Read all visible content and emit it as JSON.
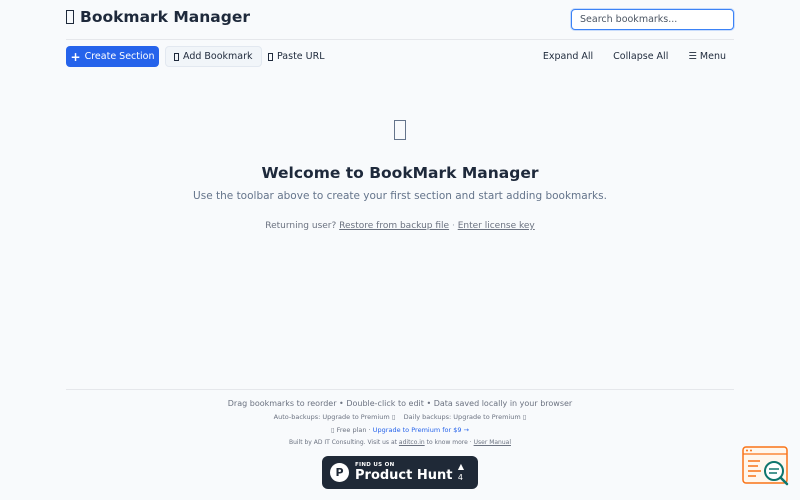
{
  "header": {
    "title": "Bookmark Manager",
    "search_placeholder": "Search bookmarks..."
  },
  "toolbar": {
    "create_section": "Create Section",
    "add_bookmark": "Add Bookmark",
    "paste_url": "Paste URL",
    "expand_all": "Expand All",
    "collapse_all": "Collapse All",
    "menu": "Menu"
  },
  "empty_state": {
    "heading": "Welcome to BookMark Manager",
    "subtitle": "Use the toolbar above to create your first section and start adding bookmarks.",
    "returning_prefix": "Returning user?",
    "restore_link": "Restore from backup file",
    "separator": "·",
    "license_link": "Enter license key"
  },
  "footer": {
    "tips": "Drag bookmarks to reorder • Double-click to edit • Data saved locally in your browser",
    "auto_backups": "Auto-backups: Upgrade to Premium",
    "daily_backups": "Daily backups: Upgrade to Premium",
    "plan": "Free plan",
    "plan_separator": "·",
    "upgrade": "Upgrade to Premium for $9 →",
    "built_by_prefix": "Built by AD IT Consulting. Visit us at",
    "built_by_link": "aditco.in",
    "built_by_suffix": "to know more",
    "manual_separator": "·",
    "user_manual": "User Manual"
  },
  "product_hunt": {
    "small": "FIND US ON",
    "big": "Product Hunt",
    "arrow": "▲",
    "count": "4"
  },
  "icons": {
    "app": "bookmark-icon",
    "create": "plus-icon",
    "menu": "hamburger-icon",
    "widget": "search-code-icon"
  },
  "colors": {
    "primary": "#2563eb",
    "background": "#f8fafc",
    "text": "#1e293b",
    "muted": "#64748b",
    "widget_orange": "#f97316",
    "widget_teal": "#0f766e"
  }
}
